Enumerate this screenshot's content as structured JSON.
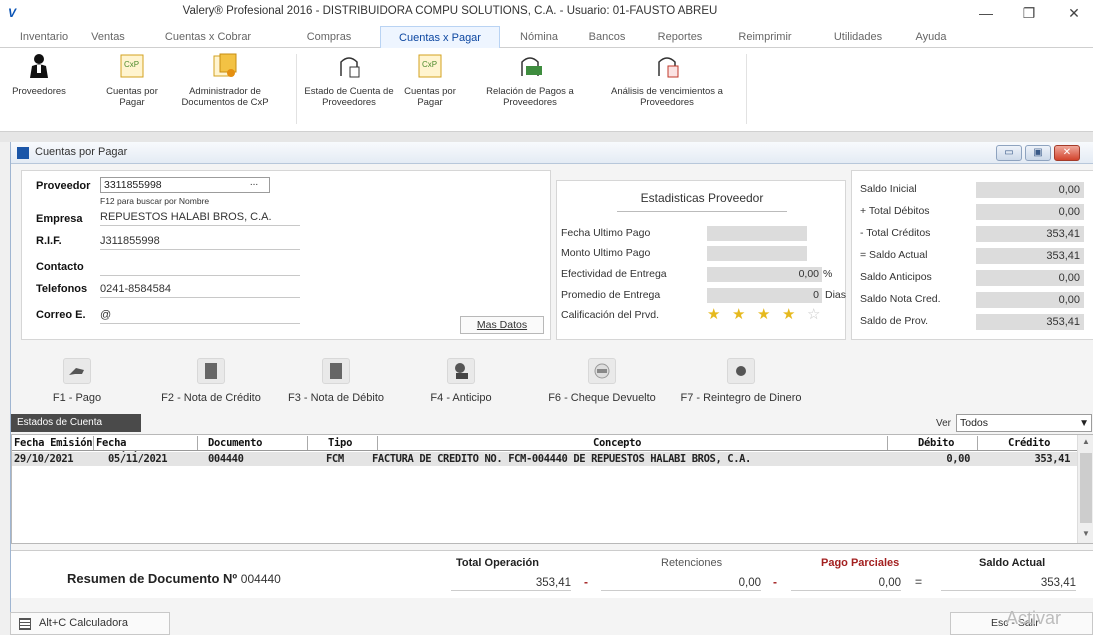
{
  "window": {
    "title": "Valery® Profesional 2016 - DISTRIBUIDORA COMPU SOLUTIONS, C.A. - Usuario: 01-FAUSTO ABREU",
    "logo": "V",
    "minimize": "—",
    "maximize": "❐",
    "close": "✕"
  },
  "menu": [
    "Inventario",
    "Ventas",
    "Cuentas x Cobrar",
    "Compras",
    "Cuentas x Pagar",
    "Nómina",
    "Bancos",
    "Reportes",
    "Reimprimir",
    "Utilidades",
    "Ayuda"
  ],
  "menu_active": "Cuentas x Pagar",
  "ribbon": [
    {
      "label": "Proveedores",
      "icon": "person-icon"
    },
    {
      "label": "Cuentas por Pagar",
      "icon": "cxp-doc-icon"
    },
    {
      "label": "Administrador de Documentos de CxP",
      "icon": "documents-admin-icon"
    },
    {
      "label": "Estado de Cuenta de Proveedores",
      "icon": "account-status-icon"
    },
    {
      "label": "Cuentas por Pagar",
      "icon": "cxp-doc-icon"
    },
    {
      "label": "Relación de Pagos a Proveedores",
      "icon": "payments-icon"
    },
    {
      "label": "Análisis de vencimientos a Proveedores",
      "icon": "due-analysis-icon"
    }
  ],
  "child_window": {
    "title": "Cuentas por Pagar",
    "btn_min": "▭",
    "btn_max": "▣",
    "btn_close": "✕"
  },
  "supplier": {
    "label_proveedor": "Proveedor",
    "proveedor_value": "3311855998",
    "dots": "...",
    "hint": "F12 para buscar por Nombre",
    "label_empresa": "Empresa",
    "empresa": "REPUESTOS HALABI BROS, C.A.",
    "label_rif": "R.I.F.",
    "rif": "J311855998",
    "label_contacto": "Contacto",
    "contacto": "",
    "label_telefonos": "Telefonos",
    "telefonos": "0241-8584584",
    "label_correo": "Correo E.",
    "correo": "@",
    "mas_datos": "Mas Datos"
  },
  "stats": {
    "title": "Estadisticas Proveedor",
    "fecha_ultimo_pago": "Fecha Ultimo Pago",
    "monto_ultimo_pago": "Monto Ultimo Pago",
    "efectividad_label": "Efectividad de Entrega",
    "efectividad_value": "0,00",
    "efectividad_unit": "%",
    "promedio_label": "Promedio de Entrega",
    "promedio_value": "0",
    "promedio_unit": "Dias",
    "calificacion_label": "Calificación del Prvd.",
    "rating": 4,
    "rating_max": 5
  },
  "balances": [
    {
      "label": "Saldo Inicial",
      "value": "0,00"
    },
    {
      "label": "+ Total Débitos",
      "value": "0,00"
    },
    {
      "label": "- Total Créditos",
      "value": "353,41"
    },
    {
      "label": "= Saldo Actual",
      "value": "353,41"
    },
    {
      "label": "Saldo Anticipos",
      "value": "0,00"
    },
    {
      "label": "Saldo Nota Cred.",
      "value": "0,00"
    },
    {
      "label": "Saldo de Prov.",
      "value": "353,41"
    }
  ],
  "actions": [
    {
      "label": "F1 - Pago",
      "icon": "payment-hand-icon"
    },
    {
      "label": "F2 - Nota de Crédito",
      "icon": "credit-note-icon"
    },
    {
      "label": "F3 - Nota de Débito",
      "icon": "debit-note-icon"
    },
    {
      "label": "F4 - Anticipo",
      "icon": "advance-icon"
    },
    {
      "label": "F6 - Cheque Devuelto",
      "icon": "returned-check-icon"
    },
    {
      "label": "F7 - Reintegro de Dinero",
      "icon": "refund-icon"
    }
  ],
  "estados": {
    "tab": "Estados de Cuenta",
    "ver_label": "Ver",
    "ver_value": "Todos",
    "dd": "▼",
    "columns": [
      "Fecha Emisión",
      "Fecha Vencimiento",
      "Documento",
      "Tipo",
      "Concepto",
      "Débito",
      "Crédito"
    ],
    "rows": [
      [
        "29/10/2021",
        "05/11/2021",
        "004440",
        "FCM",
        "FACTURA DE CREDITO NO. FCM-004440 DE REPUESTOS HALABI BROS, C.A.",
        "0,00",
        "353,41"
      ]
    ],
    "scroll_up": "▲",
    "scroll_down": "▼"
  },
  "resumen": {
    "title": "Resumen de Documento Nº",
    "doc": "004440",
    "total_label": "Total Operación",
    "total_value": "353,41",
    "minus1": "-",
    "ret_label": "Retenciones",
    "ret_value": "0,00",
    "minus2": "-",
    "pago_label": "Pago Parciales",
    "pago_value": "0,00",
    "equals": "=",
    "saldo_label": "Saldo Actual",
    "saldo_value": "353,41"
  },
  "bottom": {
    "calc": "Alt+C Calculadora",
    "exit": "Esc - Salir",
    "activate": "Activar"
  },
  "colors": {
    "accent": "#0d47a1",
    "pago_parciales": "#a32020",
    "star": "#e6b91e"
  }
}
